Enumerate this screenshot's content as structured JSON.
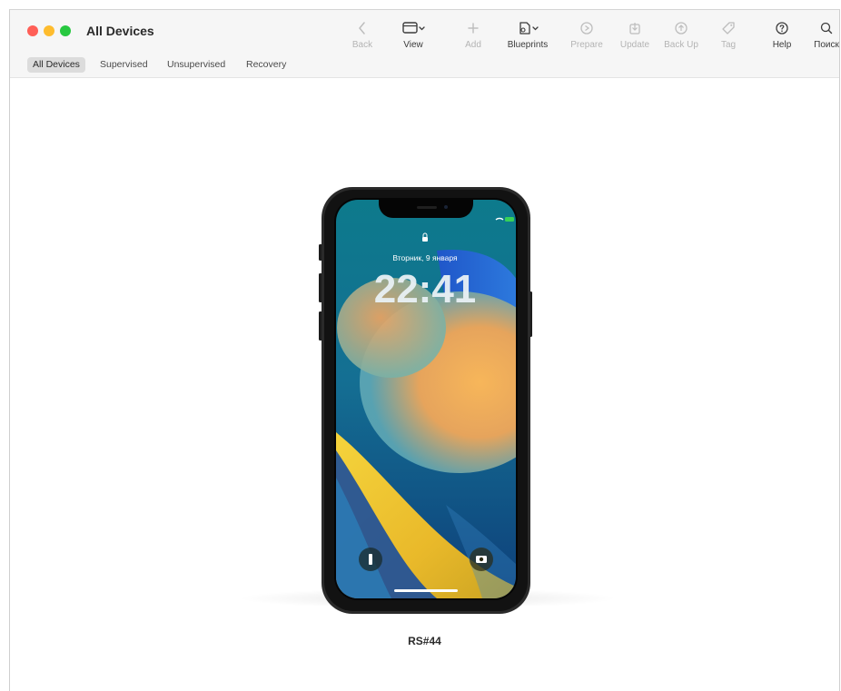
{
  "window": {
    "title": "All Devices"
  },
  "toolbar": [
    {
      "id": "back",
      "label": "Back",
      "icon": "chevron-left-icon",
      "enabled": false
    },
    {
      "id": "view",
      "label": "View",
      "icon": "view-toggle-icon",
      "enabled": true
    },
    {
      "id": "add",
      "label": "Add",
      "icon": "plus-icon",
      "enabled": false
    },
    {
      "id": "blueprints",
      "label": "Blueprints",
      "icon": "blueprints-icon",
      "enabled": true
    },
    {
      "id": "prepare",
      "label": "Prepare",
      "icon": "prepare-icon",
      "enabled": false
    },
    {
      "id": "update",
      "label": "Update",
      "icon": "update-icon",
      "enabled": false
    },
    {
      "id": "backup",
      "label": "Back Up",
      "icon": "backup-icon",
      "enabled": false
    },
    {
      "id": "tag",
      "label": "Tag",
      "icon": "tag-icon",
      "enabled": false
    },
    {
      "id": "help",
      "label": "Help",
      "icon": "help-icon",
      "enabled": true
    },
    {
      "id": "search",
      "label": "Поиск",
      "icon": "search-icon",
      "enabled": true
    }
  ],
  "scope_tabs": [
    {
      "label": "All Devices",
      "active": true
    },
    {
      "label": "Supervised",
      "active": false
    },
    {
      "label": "Unsupervised",
      "active": false
    },
    {
      "label": "Recovery",
      "active": false
    }
  ],
  "device": {
    "name": "RS#44",
    "lockscreen": {
      "date": "Вторник, 9 января",
      "time": "22:41"
    }
  },
  "colors": {
    "accent_red": "#ff5f57",
    "accent_yellow": "#febc2e",
    "accent_green": "#28c840"
  }
}
